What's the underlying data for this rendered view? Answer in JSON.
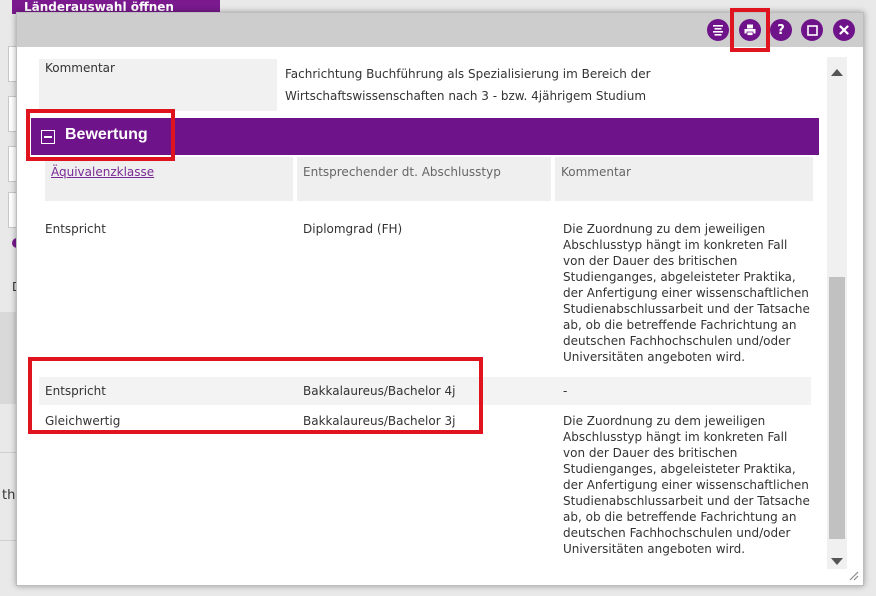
{
  "background": {
    "tab_label": "Länderauswahl öffnen",
    "fragment_text_1": "D",
    "fragment_text_2": "th"
  },
  "dialog": {
    "toolbar": {
      "filter_icon": "list-filter-icon",
      "print_icon": "print-icon",
      "help_label": "?",
      "maximize_icon": "maximize-icon",
      "close_icon": "close-icon"
    },
    "kommentar": {
      "label": "Kommentar",
      "value": "Fachrichtung Buchführung als Spezialisierung im Bereich der Wirtschaftswissenschaften nach 3 - bzw. 4jährigem Studium"
    },
    "section": {
      "title": "Bewertung",
      "toggle_icon": "collapse-minus-icon"
    },
    "table": {
      "headers": [
        "Äquivalenzklasse",
        "Entsprechender dt. Abschlusstyp",
        "Kommentar"
      ],
      "rows": [
        {
          "klasse": "Entspricht",
          "abschluss": "Diplomgrad (FH)",
          "kommentar": "Die Zuordnung zu dem jeweiligen Abschlusstyp hängt im konkreten Fall von der Dauer des britischen Studienganges, abgeleisteter Praktika, der Anfertigung einer wissenschaftlichen Studienabschlussarbeit und der Tatsache ab, ob die betreffende Fachrichtung an deutschen Fachhochschulen und/oder Universitäten angeboten wird."
        },
        {
          "klasse": "Entspricht",
          "abschluss": "Bakkalaureus/Bachelor 4j",
          "kommentar": "-"
        },
        {
          "klasse": "Gleichwertig",
          "abschluss": "Bakkalaureus/Bachelor 3j",
          "kommentar": "Die Zuordnung zu dem jeweiligen Abschlusstyp hängt im konkreten Fall von der Dauer des britischen Studienganges, abgeleisteter Praktika, der Anfertigung einer wissenschaftlichen Studienabschlussarbeit und der Tatsache ab, ob die betreffende Fachrichtung an deutschen Fachhochschulen und/oder Universitäten angeboten wird."
        }
      ]
    }
  },
  "colors": {
    "accent": "#6e1389",
    "annotation": "#e0141e"
  }
}
